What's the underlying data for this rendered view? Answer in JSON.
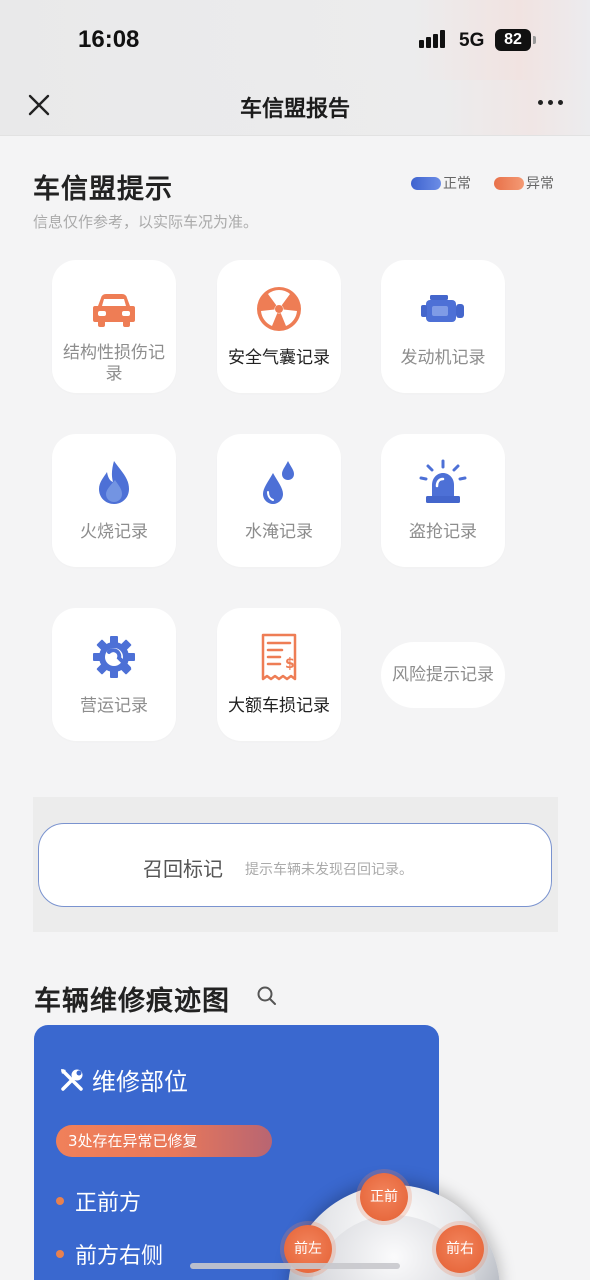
{
  "status_bar": {
    "time": "16:08",
    "network": "5G",
    "battery": "82"
  },
  "nav": {
    "title": "车信盟报告",
    "close_icon": "close-icon",
    "more_icon": "more-icon"
  },
  "tips": {
    "title": "车信盟提示",
    "subtitle": "信息仅作参考，以实际车况为准。",
    "legend": [
      {
        "label": "正常",
        "color": "#4a6fd8"
      },
      {
        "label": "异常",
        "color": "#ef7f58"
      }
    ],
    "tiles": [
      {
        "label": "结构性损伤记录",
        "icon": "car-icon",
        "status": "abnormal"
      },
      {
        "label": "安全气囊记录",
        "icon": "airbag-icon",
        "status": "abnormal"
      },
      {
        "label": "发动机记录",
        "icon": "engine-icon",
        "status": "normal"
      },
      {
        "label": "火烧记录",
        "icon": "fire-icon",
        "status": "normal"
      },
      {
        "label": "水淹记录",
        "icon": "water-drop-icon",
        "status": "normal"
      },
      {
        "label": "盗抢记录",
        "icon": "alarm-light-icon",
        "status": "normal"
      },
      {
        "label": "营运记录",
        "icon": "gear-wrench-icon",
        "status": "normal"
      },
      {
        "label": "大额车损记录",
        "icon": "receipt-icon",
        "status": "abnormal"
      },
      {
        "label": "风险提示记录",
        "icon": "",
        "status": "none"
      }
    ]
  },
  "recall": {
    "title": "召回标记",
    "text": "提示车辆未发现召回记录。"
  },
  "repair": {
    "title": "车辆维修痕迹图",
    "card_title": "维修部位",
    "warning": "3处存在异常已修复",
    "parts": [
      "正前方",
      "前方右侧"
    ],
    "markers": [
      "正前",
      "前左",
      "前右"
    ]
  }
}
